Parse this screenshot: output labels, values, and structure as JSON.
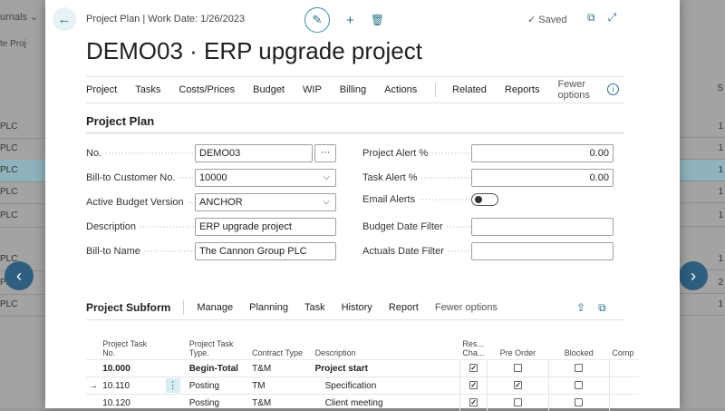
{
  "background": {
    "left_tabs": "urnals ⌄",
    "left_tab2": "te    Proj",
    "left_rows": [
      "PLC",
      "PLC",
      "PLC",
      "PLC",
      "PLC",
      "PLC",
      "PLC",
      "PLC"
    ],
    "right_header": "S",
    "right_rows": [
      "1",
      "1",
      "1",
      "1",
      "1",
      "1",
      "2",
      "1"
    ]
  },
  "header": {
    "breadcrumb": "Project Plan | Work Date: 1/26/2023",
    "saved_label": "Saved",
    "title": "DEMO03 · ERP upgrade project"
  },
  "actions": [
    "Project",
    "Tasks",
    "Costs/Prices",
    "Budget",
    "WIP",
    "Billing",
    "Actions"
  ],
  "actions_right": [
    "Related",
    "Reports",
    "Fewer options"
  ],
  "section": {
    "title": "Project Plan"
  },
  "left_fields": [
    {
      "label": "No.",
      "value": "DEMO03"
    },
    {
      "label": "Bill-to Customer No.",
      "value": "10000"
    },
    {
      "label": "Active Budget Version",
      "value": "ANCHOR"
    },
    {
      "label": "Description",
      "value": "ERP upgrade project"
    },
    {
      "label": "Bill-to Name",
      "value": "The Cannon Group PLC"
    }
  ],
  "right_fields": [
    {
      "label": "Project Alert %",
      "value": "0.00"
    },
    {
      "label": "Task Alert %",
      "value": "0.00"
    },
    {
      "label": "Email Alerts",
      "value": ""
    },
    {
      "label": "Budget Date Filter",
      "value": ""
    },
    {
      "label": "Actuals Date Filter",
      "value": ""
    }
  ],
  "subform": {
    "title": "Project Subform",
    "actions": [
      "Manage",
      "Planning",
      "Task",
      "History",
      "Report",
      "Fewer options"
    ],
    "columns": [
      "Project Task No.",
      "Project Task Type.",
      "Contract Type",
      "Description",
      "Res... Cha...",
      "Pre Order",
      "Blocked",
      "Comp"
    ],
    "rows": [
      {
        "no": "10.000",
        "type": "Begin-Total",
        "contract": "T&M",
        "desc": "Project start",
        "res": true,
        "pre": false,
        "blocked": false
      },
      {
        "no": "10.110",
        "type": "Posting",
        "contract": "TM",
        "desc": "Specification",
        "res": true,
        "pre": true,
        "blocked": false
      },
      {
        "no": "10.120",
        "type": "Posting",
        "contract": "T&M",
        "desc": "Client meeting",
        "res": true,
        "pre": false,
        "blocked": false
      }
    ]
  },
  "icons": {
    "back": "arrow-left-icon",
    "edit": "pencil-icon",
    "add": "plus-icon",
    "delete": "trash-icon",
    "saved": "checkmark-icon",
    "open_new": "open-in-new-window-icon",
    "expand": "expand-icon",
    "info": "info-icon",
    "share": "share-icon",
    "focus": "focus-mode-icon"
  },
  "colors": {
    "accent": "#26718a",
    "nav_button": "#2f5f7f"
  }
}
